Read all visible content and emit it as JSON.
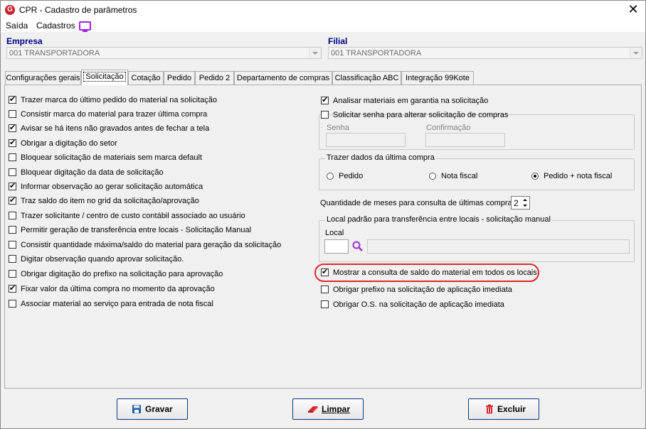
{
  "window": {
    "title": "CPR - Cadastro de parâmetros",
    "app_icon_letter": "G"
  },
  "menu": {
    "items": [
      "Saída",
      "Cadastros"
    ]
  },
  "empresa": {
    "label": "Empresa",
    "value": "001 TRANSPORTADORA"
  },
  "filial": {
    "label": "Filial",
    "value": "001 TRANSPORTADORA"
  },
  "tabs": [
    "Configurações gerais",
    "Solicitação",
    "Cotação",
    "Pedido",
    "Pedido 2",
    "Departamento de compras",
    "Classificação ABC",
    "Integração 99Kote"
  ],
  "active_tab": "Solicitação",
  "left_options": [
    {
      "label": "Trazer marca do último pedido do material na solicitação",
      "checked": true
    },
    {
      "label": "Consistir marca do material para trazer última compra",
      "checked": false
    },
    {
      "label": "Avisar se há itens não gravados antes de fechar a tela",
      "checked": true
    },
    {
      "label": "Obrigar a digitação do setor",
      "checked": true
    },
    {
      "label": "Bloquear solicitação de materiais sem marca default",
      "checked": false
    },
    {
      "label": "Bloquear digitação da data de solicitação",
      "checked": false
    },
    {
      "label": "Informar observação ao gerar solicitação automática",
      "checked": true
    },
    {
      "label": "Traz saldo do item no grid da solicitação/aprovação",
      "checked": true
    },
    {
      "label": "Trazer solicitante / centro de custo contábil associado ao usuário",
      "checked": false
    },
    {
      "label": "Permitir geração de transferência entre locais - Solicitação Manual",
      "checked": false
    },
    {
      "label": "Consistir quantidade máxima/saldo do material para geração da solicitação",
      "checked": false
    },
    {
      "label": "Digitar observação quando aprovar solicitação.",
      "checked": false
    },
    {
      "label": "Obrigar digitação do prefixo na solicitação para aprovação",
      "checked": false
    },
    {
      "label": "Fixar valor da última compra no momento da aprovação",
      "checked": true
    },
    {
      "label": "Associar material ao serviço para entrada de nota fiscal",
      "checked": false
    }
  ],
  "right": {
    "garantia": {
      "label": "Analisar materiais em garantia na solicitação",
      "checked": true
    },
    "senha_option": {
      "label": "Solicitar senha para alterar solicitação de compras",
      "checked": false
    },
    "senha_label": "Senha",
    "confirmacao_label": "Confirmação",
    "ultima_compra_group": "Trazer dados da última compra",
    "radios": [
      {
        "label": "Pedido",
        "selected": false
      },
      {
        "label": "Nota fiscal",
        "selected": false
      },
      {
        "label": "Pedido + nota fiscal",
        "selected": true
      }
    ],
    "meses_label": "Quantidade de meses para consulta de últimas compras",
    "meses_value": "2",
    "local_group": "Local padrão para transferência entre locais - solicitação manual",
    "local_label": "Local",
    "local_code": "",
    "local_desc": "",
    "saldo_option": {
      "label": "Mostrar a consulta de saldo do material em todos os locais",
      "checked": true
    },
    "prefixo_option": {
      "label": "Obrigar prefixo na solicitação de aplicação imediata",
      "checked": false
    },
    "os_option": {
      "label": "Obrigar O.S. na solicitação de aplicação imediata",
      "checked": false
    }
  },
  "buttons": {
    "gravar": "Gravar",
    "limpar": "Limpar",
    "excluir": "Excluir"
  },
  "colors": {
    "highlight": "#e0292a",
    "label_blue": "#000080",
    "menu_icon": "#a020f0"
  }
}
